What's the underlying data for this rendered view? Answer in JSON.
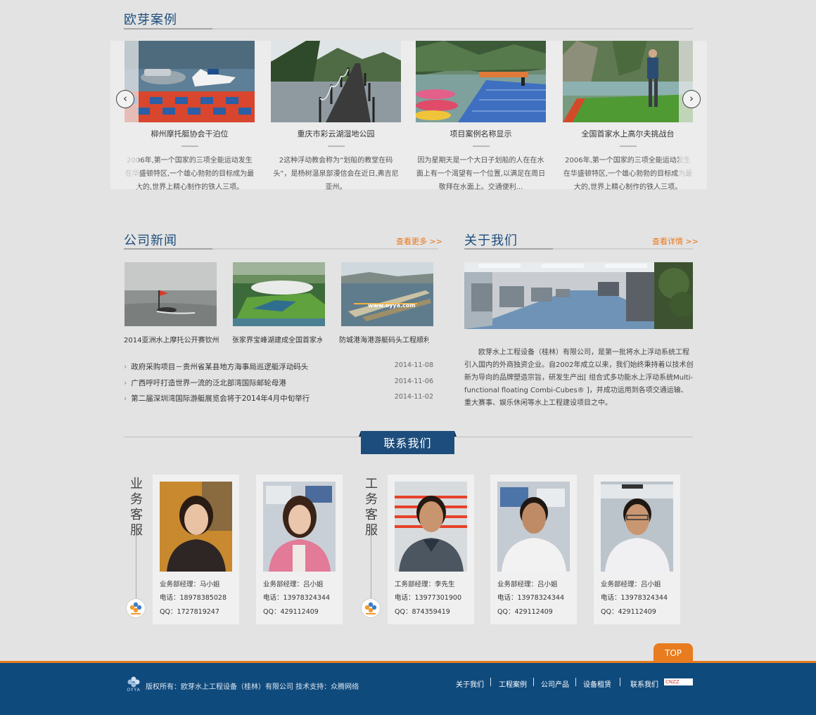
{
  "cases": {
    "title": "欧芽案例",
    "items": [
      {
        "title": "柳州摩托艇协会干泊位",
        "desc": "2006年,第一个国家的三项全能运动发生在华盛顿特区,一个雄心勃勃的目标成为最大的,世界上精心制作的铁人三项。"
      },
      {
        "title": "重庆市彩云湖湿地公园",
        "desc": "2这种浮动教会称为“划船的教堂在码头”，是杨树温泉部漫信会在近日,弗吉尼亚州。"
      },
      {
        "title": "项目案例名称显示",
        "desc": "因为星期天是一个大日子划船的人在在水面上有一个渴望有一个位置,以满足在周日敬拜在水面上。交通便利..."
      },
      {
        "title": "全国首家水上高尔夫挑战台",
        "desc": "2006年,第一个国家的三项全能运动发生在华盛顿特区,一个雄心勃勃的目标成为最大的,世界上精心制作的铁人三项。"
      }
    ],
    "prev_icon": "chevron-left-icon",
    "next_icon": "chevron-right-icon"
  },
  "news": {
    "title": "公司新闻",
    "more": "查看更多 >>",
    "pics": [
      {
        "caption": "2014亚洲水上摩托公开赛钦州"
      },
      {
        "caption": "张家界宝峰湖建成全国首家水"
      },
      {
        "caption": "防城港海港游艇码头工程顺利"
      }
    ],
    "list": [
      {
        "text": "政府采购项目－贵州省某县地方海事局巡逻艇浮动码头",
        "date": "2014-11-08"
      },
      {
        "text": "广西呼吁打造世界一流的泛北部湾国际邮轮母港",
        "date": "2014-11-06"
      },
      {
        "text": "第二届深圳湾国际游艇展览会将于2014年4月中旬举行",
        "date": "2014-11-02"
      }
    ]
  },
  "about": {
    "title": "关于我们",
    "more": "查看详情 >>",
    "text": "欧芽水上工程设备（桂林）有限公司，是第一批将水上浮动系统工程引入国内的外商独资企业。自2002年成立以来，我们始终秉持着以技术创新为导向的品牌塑造宗旨，研发生产出[ 组合式多功能水上浮动系统Multi-functional floating Combi-Cubes® ]，并成功运用到各项交通运输、重大赛事、娱乐休闲等水上工程建设项目之中。"
  },
  "contact": {
    "title": "联系我们",
    "group1": "业务客服",
    "group2": "工务客服",
    "cards": [
      {
        "role": "业务部经理：马小姐",
        "phone": "电话：18978385028",
        "qq": "QQ：1727819247"
      },
      {
        "role": "业务部经理：吕小姐",
        "phone": "电话：13978324344",
        "qq": "QQ：429112409"
      },
      {
        "role": "工务部经理：李先生",
        "phone": "电话：13977301900",
        "qq": "QQ：874359419"
      },
      {
        "role": "业务部经理：吕小姐",
        "phone": "电话：13978324344",
        "qq": "QQ：429112409"
      },
      {
        "role": "业务部经理：吕小姐",
        "phone": "电话：13978324344",
        "qq": "QQ：429112409"
      }
    ]
  },
  "footer": {
    "top": "TOP",
    "copyright": "版权所有：欧芽水上工程设备（桂林）有限公司  技术支持：众腾网络",
    "logo_text": "OYYA",
    "nav": [
      "关于我们",
      "工程案例",
      "公司产品",
      "设备租赁",
      "联系我们"
    ],
    "badge": "CNZZ"
  },
  "colors": {
    "brand_blue": "#1d4d7c",
    "accent_orange": "#e87c1e",
    "footer_blue": "#0f4a7d"
  }
}
